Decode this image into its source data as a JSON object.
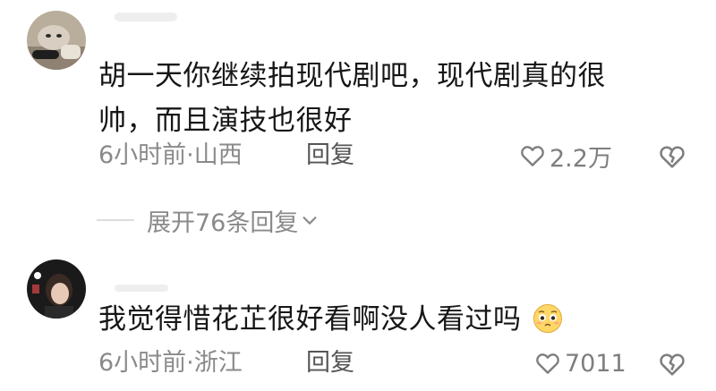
{
  "comments": [
    {
      "avatar_icon": "cat-photo-avatar",
      "text_line1": "胡一天你继续拍现代剧吧，现代剧真的很",
      "text_line2": "帅，而且演技也很好",
      "time_location": "6小时前·山西",
      "reply_label": "回复",
      "like_count": "2.2万",
      "dislike_icon": "broken-heart-icon"
    },
    {
      "avatar_icon": "girl-photo-avatar",
      "text": "我觉得惜花芷很好看啊没人看过吗",
      "emoji_icon": "pleading-face-emoji",
      "time_location": "6小时前·浙江",
      "reply_label": "回复",
      "like_count": "7011",
      "dislike_icon": "broken-heart-icon"
    }
  ],
  "expand_replies": {
    "label": "展开76条回复",
    "icon": "chevron-down-icon"
  },
  "colors": {
    "text": "#161616",
    "meta": "#8a8a8a",
    "background": "#ffffff"
  }
}
